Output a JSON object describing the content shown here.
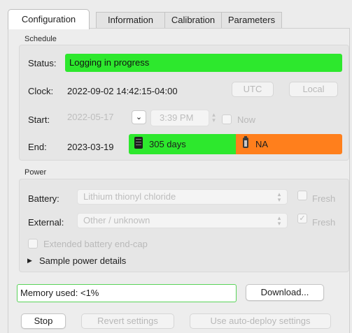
{
  "tabs": [
    "Configuration",
    "Information",
    "Calibration",
    "Parameters"
  ],
  "schedule": {
    "group_label": "Schedule",
    "status_label": "Status:",
    "status_value": "Logging in progress",
    "clock_label": "Clock:",
    "clock_value": "2022-09-02 14:42:15-04:00",
    "utc_button": "UTC",
    "local_button": "Local",
    "start_label": "Start:",
    "start_date": "2022-05-17",
    "start_time": "3:39 PM",
    "now_label": "Now",
    "end_label": "End:",
    "end_date": "2023-03-19",
    "memory_days": "305 days",
    "battery_estimate": "NA"
  },
  "power": {
    "group_label": "Power",
    "battery_label": "Battery:",
    "battery_value": "Lithium thionyl chloride",
    "fresh_label": "Fresh",
    "external_label": "External:",
    "external_value": "Other / unknown",
    "external_fresh_label": "Fresh",
    "extended_endcap_label": "Extended battery end-cap",
    "sample_power_label": "Sample power details"
  },
  "memory": {
    "text": "Memory used: <1%",
    "download_button": "Download..."
  },
  "actions": {
    "stop": "Stop",
    "revert": "Revert settings",
    "auto_deploy": "Use auto-deploy settings"
  },
  "colors": {
    "status_green": "#2de82d",
    "battery_orange": "#ff7f1c"
  }
}
